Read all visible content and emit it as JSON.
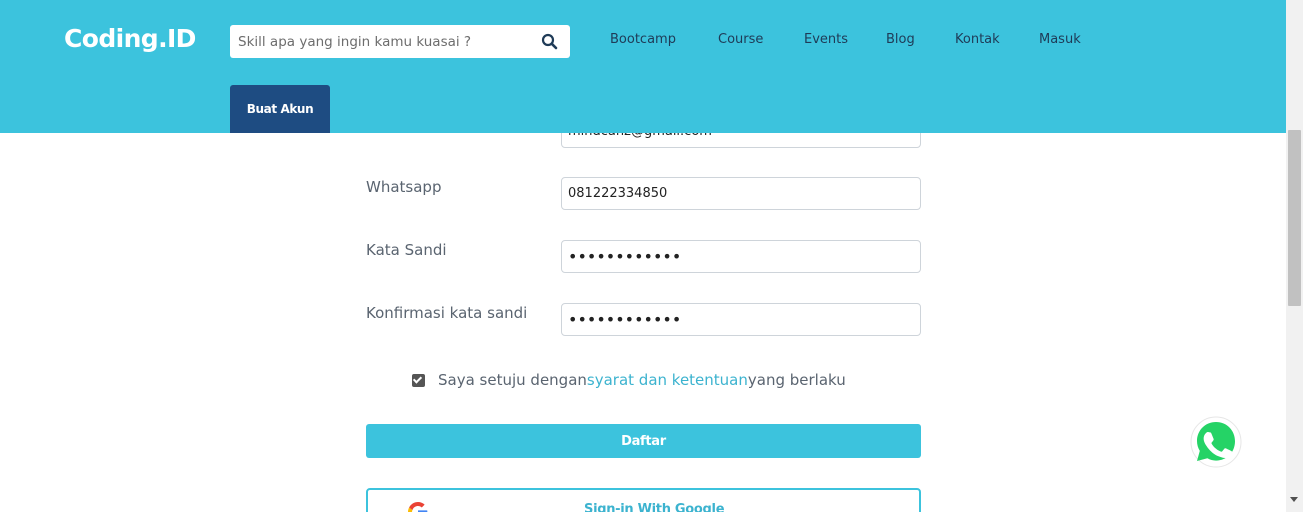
{
  "header": {
    "logo": "Coding.ID",
    "search": {
      "placeholder": "Skill apa yang ingin kamu kuasai ?",
      "value": ""
    },
    "nav": [
      "Bootcamp",
      "Course",
      "Events",
      "Blog",
      "Kontak",
      "Masuk"
    ],
    "signup_label": "Buat Akun"
  },
  "form": {
    "email_value": "mindcanz@gmail.com",
    "whatsapp_label": "Whatsapp",
    "whatsapp_value": "081222334850",
    "password_label": "Kata Sandi",
    "password_value": "••••••••••••",
    "confirm_label": "Konfirmasi kata sandi",
    "confirm_value": "••••••••••••",
    "agree": {
      "checked": true,
      "prefix": "Saya setuju dengan ",
      "link": "syarat dan ketentuan",
      "suffix": " yang berlaku"
    },
    "submit_label": "Daftar",
    "google_label": "Sign-in With Google"
  },
  "colors": {
    "header_bg": "#3cc3dd",
    "primary_button": "#1e4c82",
    "accent": "#3cc3dd",
    "link": "#3cb3cf",
    "whatsapp": "#25d366"
  },
  "icons": {
    "search": "search-icon",
    "checkbox": "check-icon",
    "google": "google-icon",
    "whatsapp": "whatsapp-icon"
  }
}
